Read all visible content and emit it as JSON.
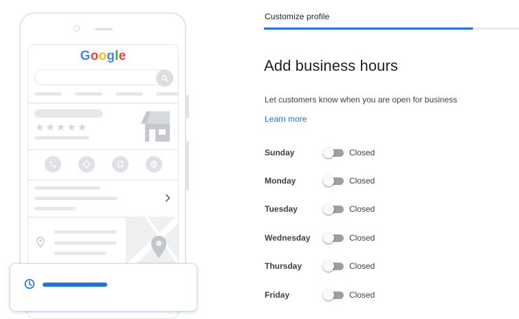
{
  "illustration": {
    "logo_letters": [
      "G",
      "o",
      "o",
      "g",
      "l",
      "e"
    ],
    "rating_stars": "★★★★★"
  },
  "header": {
    "step_label": "Customize profile",
    "progress_fraction": 0.82
  },
  "main": {
    "title": "Add business hours",
    "description": "Let customers know when you are open for business",
    "learn_more": "Learn more"
  },
  "hours": [
    {
      "day": "Sunday",
      "status": "Closed",
      "open": false
    },
    {
      "day": "Monday",
      "status": "Closed",
      "open": false
    },
    {
      "day": "Tuesday",
      "status": "Closed",
      "open": false
    },
    {
      "day": "Wednesday",
      "status": "Closed",
      "open": false
    },
    {
      "day": "Thursday",
      "status": "Closed",
      "open": false
    },
    {
      "day": "Friday",
      "status": "Closed",
      "open": false
    }
  ],
  "colors": {
    "accent": "#1a73e8",
    "toggle_off_track": "#9aa0a6",
    "placeholder_gray": "#e6e8ea"
  }
}
